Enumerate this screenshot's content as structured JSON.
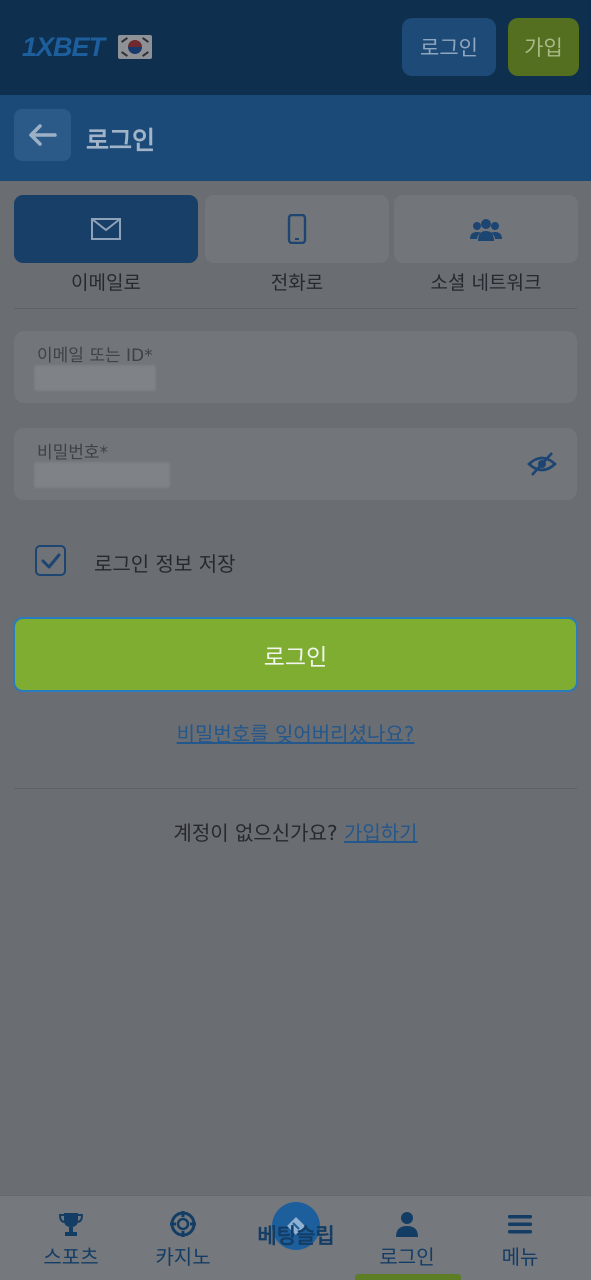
{
  "header": {
    "logo_text": "1XBET",
    "login_button": "로그인",
    "signup_button": "가입"
  },
  "subheader": {
    "title": "로그인"
  },
  "tabs": [
    {
      "label": "이메일로",
      "icon": "envelope-icon",
      "selected": true
    },
    {
      "label": "전화로",
      "icon": "phone-icon",
      "selected": false
    },
    {
      "label": "소셜 네트워크",
      "icon": "users-icon",
      "selected": false
    }
  ],
  "form": {
    "email_label": "이메일 또는 ID*",
    "password_label": "비밀번호*",
    "remember_label": "로그인 정보 저장",
    "remember_checked": true,
    "submit_label": "로그인",
    "forgot_link": "비밀번호를 잊어버리셨나요?",
    "no_account_text": "계정이 없으신가요?",
    "signup_link": "가입하기"
  },
  "bottom_nav": [
    {
      "label": "스포츠",
      "icon": "trophy-icon"
    },
    {
      "label": "카지노",
      "icon": "casino-chip-icon"
    },
    {
      "label": "베팅슬립",
      "icon": "ticket-icon"
    },
    {
      "label": "로그인",
      "icon": "user-icon",
      "active": true
    },
    {
      "label": "메뉴",
      "icon": "menu-icon"
    }
  ],
  "colors": {
    "brand_blue": "#1c5f9c",
    "accent_green": "#7fad31",
    "link_blue": "#24578b"
  }
}
